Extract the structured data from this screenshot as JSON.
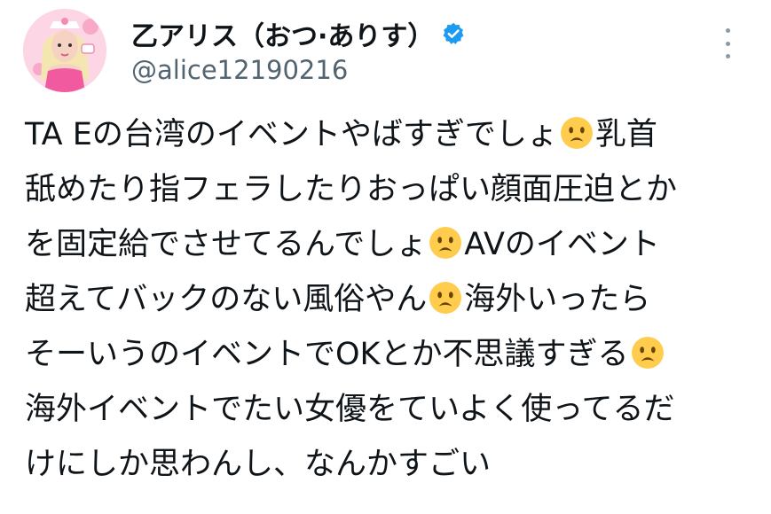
{
  "author": {
    "display_name": "乙アリス（おつ·ありす）",
    "handle": "@alice12190216",
    "verified": true,
    "avatar_icon": "profile-photo",
    "verified_icon": "verified-badge-icon",
    "more_icon": "more-options-icon"
  },
  "tweet": {
    "lines": [
      {
        "text": "TA Eの台湾のイベントやばすぎでしょ",
        "emoji": "worried-face-emoji",
        "after": "乳首"
      },
      {
        "text": "舐めたり指フェラしたりおっぱい顔面圧迫とか",
        "emoji": null,
        "after": ""
      },
      {
        "text": "を固定給でさせてるんでしょ",
        "emoji": "worried-face-emoji",
        "after": "AVのイベント"
      },
      {
        "text": "超えてバックのない風俗やん",
        "emoji": "worried-face-emoji",
        "after": "海外いったら"
      },
      {
        "text": "そーいうのイベントでOKとか不思議すぎる",
        "emoji": "worried-face-emoji",
        "after": ""
      },
      {
        "text": "海外イベントでたい女優をていよく使ってるだ",
        "emoji": null,
        "after": ""
      },
      {
        "text": "けにしか思わんし、なんかすごい",
        "emoji": null,
        "after": ""
      }
    ]
  },
  "colors": {
    "text": "#0f1419",
    "secondary": "#536471",
    "verified_blue": "#1d9bf0",
    "emoji_yellow": "#ffcc4d"
  }
}
